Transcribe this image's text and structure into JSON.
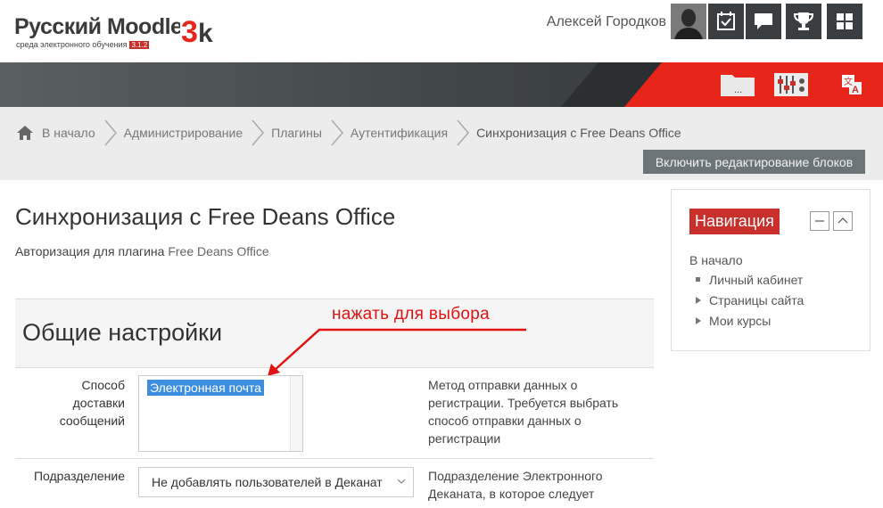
{
  "logo": {
    "title": "Русский Moodle",
    "subtitle": "среда электронного обучения",
    "version": "3.1.2",
    "mark": "3k"
  },
  "header": {
    "username": "Алексей Городков",
    "icons": [
      "avatar",
      "calendar-icon",
      "messages-icon",
      "trophy-icon",
      "grid-icon"
    ]
  },
  "band": {
    "icons": [
      "folder-icon",
      "settings-panel-icon",
      "language-icon"
    ],
    "folder_label": "..."
  },
  "breadcrumb": {
    "items": [
      "В начало",
      "Администрирование",
      "Плагины",
      "Аутентификация",
      "Синхронизация с Free Deans Office"
    ]
  },
  "edit_button": "Включить редактирование блоков",
  "page": {
    "title": "Синхронизация с Free Deans Office",
    "subtitle_prefix": "Авторизация для плагина ",
    "subtitle_plugin": "Free Deans Office"
  },
  "section": {
    "title": "Общие настройки",
    "hint": "нажать для выбора"
  },
  "fields": {
    "delivery": {
      "label": "Способ доставки сообщений",
      "option": "Электронная почта",
      "description": "Метод отправки данных о регистрации. Требуется выбрать способ отправки данных о регистрации"
    },
    "department": {
      "label": "Подразделение",
      "value": "Не добавлять пользователей в Деканат",
      "description": "Подразделение Электронного Деканата, в которое следует"
    }
  },
  "navigation": {
    "title": "Навигация",
    "home": "В начало",
    "items": [
      "Личный кабинет",
      "Страницы сайта",
      "Мои курсы"
    ]
  },
  "colors": {
    "accent_red": "#c9302c",
    "band_red": "#e8251b",
    "selection_blue": "#3d8ee0",
    "dark_button": "#3b3e40"
  }
}
